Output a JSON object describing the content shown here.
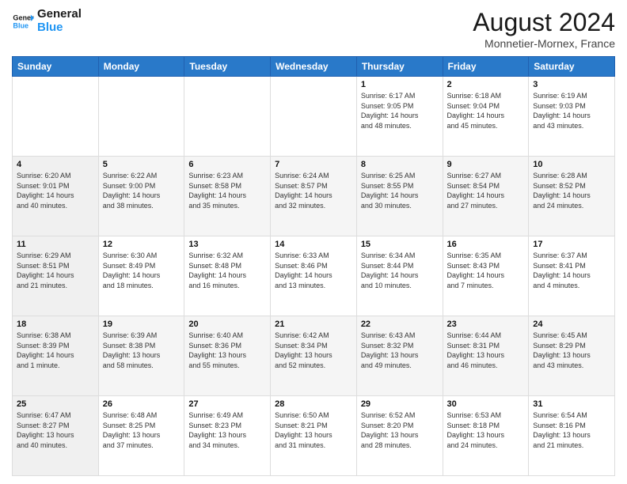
{
  "logo": {
    "line1": "General",
    "line2": "Blue"
  },
  "title": {
    "month_year": "August 2024",
    "location": "Monnetier-Mornex, France"
  },
  "days_of_week": [
    "Sunday",
    "Monday",
    "Tuesday",
    "Wednesday",
    "Thursday",
    "Friday",
    "Saturday"
  ],
  "weeks": [
    {
      "days": [
        {
          "num": "",
          "info": ""
        },
        {
          "num": "",
          "info": ""
        },
        {
          "num": "",
          "info": ""
        },
        {
          "num": "",
          "info": ""
        },
        {
          "num": "1",
          "info": "Sunrise: 6:17 AM\nSunset: 9:05 PM\nDaylight: 14 hours\nand 48 minutes."
        },
        {
          "num": "2",
          "info": "Sunrise: 6:18 AM\nSunset: 9:04 PM\nDaylight: 14 hours\nand 45 minutes."
        },
        {
          "num": "3",
          "info": "Sunrise: 6:19 AM\nSunset: 9:03 PM\nDaylight: 14 hours\nand 43 minutes."
        }
      ]
    },
    {
      "days": [
        {
          "num": "4",
          "info": "Sunrise: 6:20 AM\nSunset: 9:01 PM\nDaylight: 14 hours\nand 40 minutes."
        },
        {
          "num": "5",
          "info": "Sunrise: 6:22 AM\nSunset: 9:00 PM\nDaylight: 14 hours\nand 38 minutes."
        },
        {
          "num": "6",
          "info": "Sunrise: 6:23 AM\nSunset: 8:58 PM\nDaylight: 14 hours\nand 35 minutes."
        },
        {
          "num": "7",
          "info": "Sunrise: 6:24 AM\nSunset: 8:57 PM\nDaylight: 14 hours\nand 32 minutes."
        },
        {
          "num": "8",
          "info": "Sunrise: 6:25 AM\nSunset: 8:55 PM\nDaylight: 14 hours\nand 30 minutes."
        },
        {
          "num": "9",
          "info": "Sunrise: 6:27 AM\nSunset: 8:54 PM\nDaylight: 14 hours\nand 27 minutes."
        },
        {
          "num": "10",
          "info": "Sunrise: 6:28 AM\nSunset: 8:52 PM\nDaylight: 14 hours\nand 24 minutes."
        }
      ]
    },
    {
      "days": [
        {
          "num": "11",
          "info": "Sunrise: 6:29 AM\nSunset: 8:51 PM\nDaylight: 14 hours\nand 21 minutes."
        },
        {
          "num": "12",
          "info": "Sunrise: 6:30 AM\nSunset: 8:49 PM\nDaylight: 14 hours\nand 18 minutes."
        },
        {
          "num": "13",
          "info": "Sunrise: 6:32 AM\nSunset: 8:48 PM\nDaylight: 14 hours\nand 16 minutes."
        },
        {
          "num": "14",
          "info": "Sunrise: 6:33 AM\nSunset: 8:46 PM\nDaylight: 14 hours\nand 13 minutes."
        },
        {
          "num": "15",
          "info": "Sunrise: 6:34 AM\nSunset: 8:44 PM\nDaylight: 14 hours\nand 10 minutes."
        },
        {
          "num": "16",
          "info": "Sunrise: 6:35 AM\nSunset: 8:43 PM\nDaylight: 14 hours\nand 7 minutes."
        },
        {
          "num": "17",
          "info": "Sunrise: 6:37 AM\nSunset: 8:41 PM\nDaylight: 14 hours\nand 4 minutes."
        }
      ]
    },
    {
      "days": [
        {
          "num": "18",
          "info": "Sunrise: 6:38 AM\nSunset: 8:39 PM\nDaylight: 14 hours\nand 1 minute."
        },
        {
          "num": "19",
          "info": "Sunrise: 6:39 AM\nSunset: 8:38 PM\nDaylight: 13 hours\nand 58 minutes."
        },
        {
          "num": "20",
          "info": "Sunrise: 6:40 AM\nSunset: 8:36 PM\nDaylight: 13 hours\nand 55 minutes."
        },
        {
          "num": "21",
          "info": "Sunrise: 6:42 AM\nSunset: 8:34 PM\nDaylight: 13 hours\nand 52 minutes."
        },
        {
          "num": "22",
          "info": "Sunrise: 6:43 AM\nSunset: 8:32 PM\nDaylight: 13 hours\nand 49 minutes."
        },
        {
          "num": "23",
          "info": "Sunrise: 6:44 AM\nSunset: 8:31 PM\nDaylight: 13 hours\nand 46 minutes."
        },
        {
          "num": "24",
          "info": "Sunrise: 6:45 AM\nSunset: 8:29 PM\nDaylight: 13 hours\nand 43 minutes."
        }
      ]
    },
    {
      "days": [
        {
          "num": "25",
          "info": "Sunrise: 6:47 AM\nSunset: 8:27 PM\nDaylight: 13 hours\nand 40 minutes."
        },
        {
          "num": "26",
          "info": "Sunrise: 6:48 AM\nSunset: 8:25 PM\nDaylight: 13 hours\nand 37 minutes."
        },
        {
          "num": "27",
          "info": "Sunrise: 6:49 AM\nSunset: 8:23 PM\nDaylight: 13 hours\nand 34 minutes."
        },
        {
          "num": "28",
          "info": "Sunrise: 6:50 AM\nSunset: 8:21 PM\nDaylight: 13 hours\nand 31 minutes."
        },
        {
          "num": "29",
          "info": "Sunrise: 6:52 AM\nSunset: 8:20 PM\nDaylight: 13 hours\nand 28 minutes."
        },
        {
          "num": "30",
          "info": "Sunrise: 6:53 AM\nSunset: 8:18 PM\nDaylight: 13 hours\nand 24 minutes."
        },
        {
          "num": "31",
          "info": "Sunrise: 6:54 AM\nSunset: 8:16 PM\nDaylight: 13 hours\nand 21 minutes."
        }
      ]
    }
  ]
}
